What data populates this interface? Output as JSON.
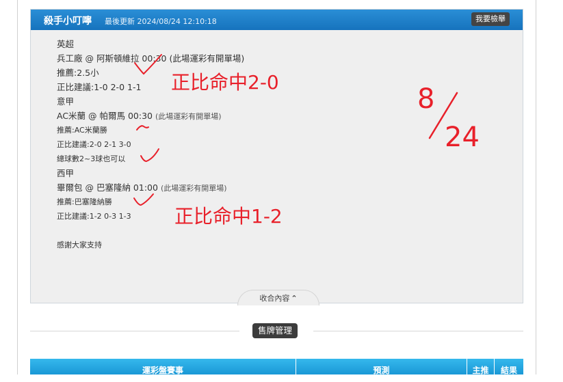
{
  "header": {
    "author": "殺手小叮嚀",
    "updated": "最後更新 2024/08/24 12:10:18",
    "report_button": "我要檢舉"
  },
  "content": {
    "league1": "英超",
    "match1": "兵工廠 @ 阿斯頓維拉 00:30",
    "match1_note": "(此場運彩有開單場)",
    "rec1": "推薦:2.5小",
    "score1": "正比建議:1-0 2-0 1-1",
    "league2": "意甲",
    "match2": "AC米蘭 @ 帕爾馬 00:30",
    "match2_note": "(此場運彩有開單場)",
    "rec2": "推薦:AC米蘭勝",
    "score2": "正比建議:2-0 2-1 3-0",
    "total2": "總球數2~3球也可以",
    "league3": "西甲",
    "match3": "畢爾包 @ 巴塞隆納 01:00",
    "match3_note": "(此場運彩有開單場)",
    "rec3": "推薦:巴塞隆納勝",
    "score3": "正比建議:1-2 0-3 1-3",
    "thanks": "感謝大家支持"
  },
  "collapse_label": "收合內容",
  "handwriting": {
    "hit1": "正比命中2-0",
    "hit2": "正比命中1-2",
    "date_top": "8",
    "date_bottom": "24",
    "color": "#e8202a"
  },
  "sales_button": "售牌管理",
  "table": {
    "headers": [
      "運彩盤賽事",
      "預測",
      "主推",
      "結果"
    ]
  },
  "colors": {
    "header_blue": "#1673bd",
    "table_blue": "#1a98d6",
    "card_bg": "#efefef"
  }
}
